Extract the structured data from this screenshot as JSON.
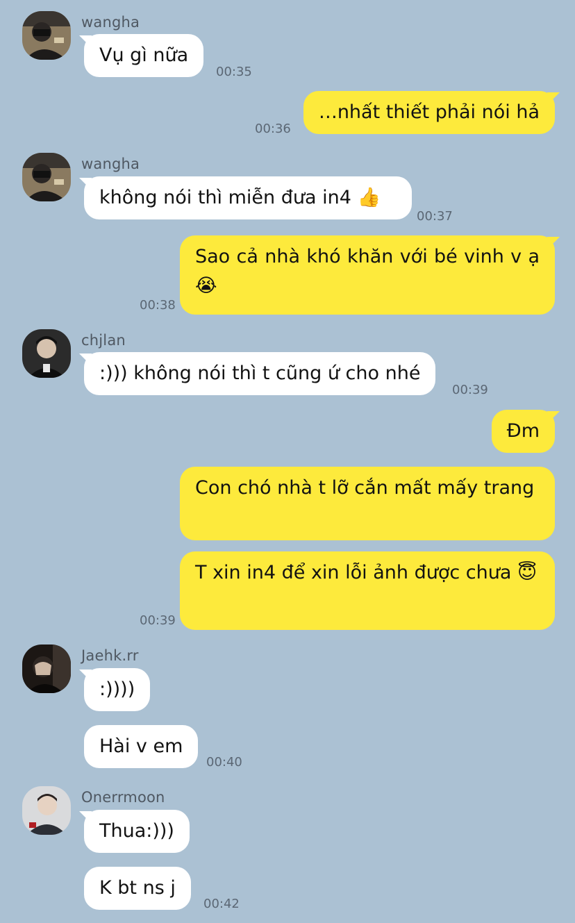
{
  "colors": {
    "background": "#abc1d3",
    "incoming_bubble": "#ffffff",
    "outgoing_bubble": "#fdea3c",
    "timestamp": "#5b6774",
    "sender_name": "#4f5862"
  },
  "messages": {
    "m1": {
      "sender": "wangha",
      "text": "Vụ gì nữa",
      "time": "00:35"
    },
    "m2": {
      "text": "…nhất thiết phải nói hả",
      "time": "00:36"
    },
    "m3": {
      "sender": "wangha",
      "text": "không nói thì miễn đưa in4 👍",
      "time": "00:37"
    },
    "m4": {
      "text": "Sao cả nhà khó khăn với bé vinh v ạ😭",
      "time": "00:38"
    },
    "m5": {
      "sender": "chjlan",
      "text": ":))) không nói thì t cũng ứ cho nhé",
      "time": "00:39"
    },
    "m6": {
      "text": "Đm"
    },
    "m7": {
      "text": "Con chó nhà t lỡ cắn mất mấy trang"
    },
    "m8": {
      "text": "T xin in4 để xin lỗi ảnh được chưa 😇",
      "time": "00:39"
    },
    "m9": {
      "sender": "Jaehk.rr",
      "text": ":))))"
    },
    "m10": {
      "text": "Hài v em",
      "time": "00:40"
    },
    "m11": {
      "sender": "Onerrmoon",
      "text": "Thua:)))"
    },
    "m12": {
      "text": "K bt ns j",
      "time": "00:42"
    }
  }
}
